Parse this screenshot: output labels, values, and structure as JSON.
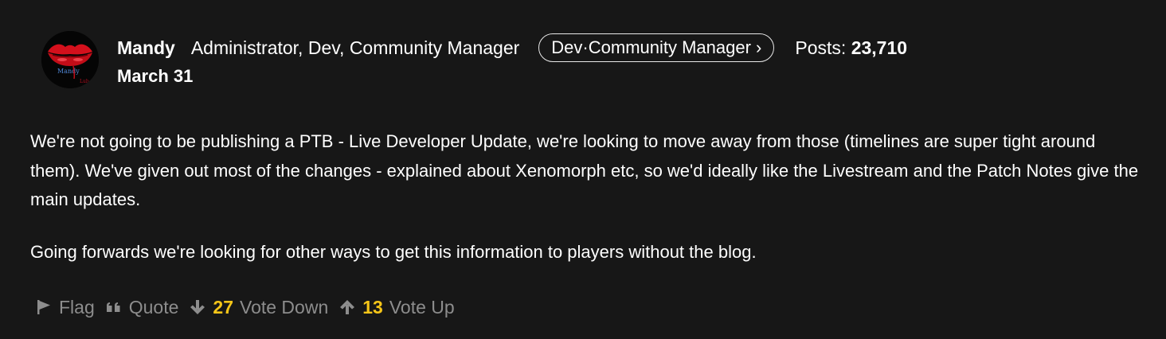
{
  "author": {
    "name": "Mandy",
    "roles": "Administrator, Dev, Community Manager",
    "rank": "Dev·Community Manager ›",
    "posts_label": "Posts:",
    "posts_count": "23,710",
    "avatar_text_1": "Mandy",
    "avatar_text_2": "Lub"
  },
  "post": {
    "date": "March 31",
    "paragraphs": [
      "We're not going to be publishing a PTB - Live Developer Update, we're looking to move away from those (timelines are super tight around them). We've given out most of the changes - explained about Xenomorph etc, so we'd ideally like the Livestream and the Patch Notes give the main updates.",
      "Going forwards we're looking for other ways to get this information to players without the blog."
    ]
  },
  "reactions": {
    "flag_label": "Flag",
    "quote_label": "Quote",
    "vote_down_count": "27",
    "vote_down_label": "Vote Down",
    "vote_up_count": "13",
    "vote_up_label": "Vote Up"
  },
  "colors": {
    "background": "#171717",
    "text": "#ffffff",
    "muted": "#8d8d8d",
    "count_accent": "#f5c518",
    "avatar_lips": "#d4101c"
  },
  "icons": {
    "flag": "flag-icon",
    "quote": "quote-icon",
    "vote_down": "arrow-down-icon",
    "vote_up": "arrow-up-icon"
  }
}
